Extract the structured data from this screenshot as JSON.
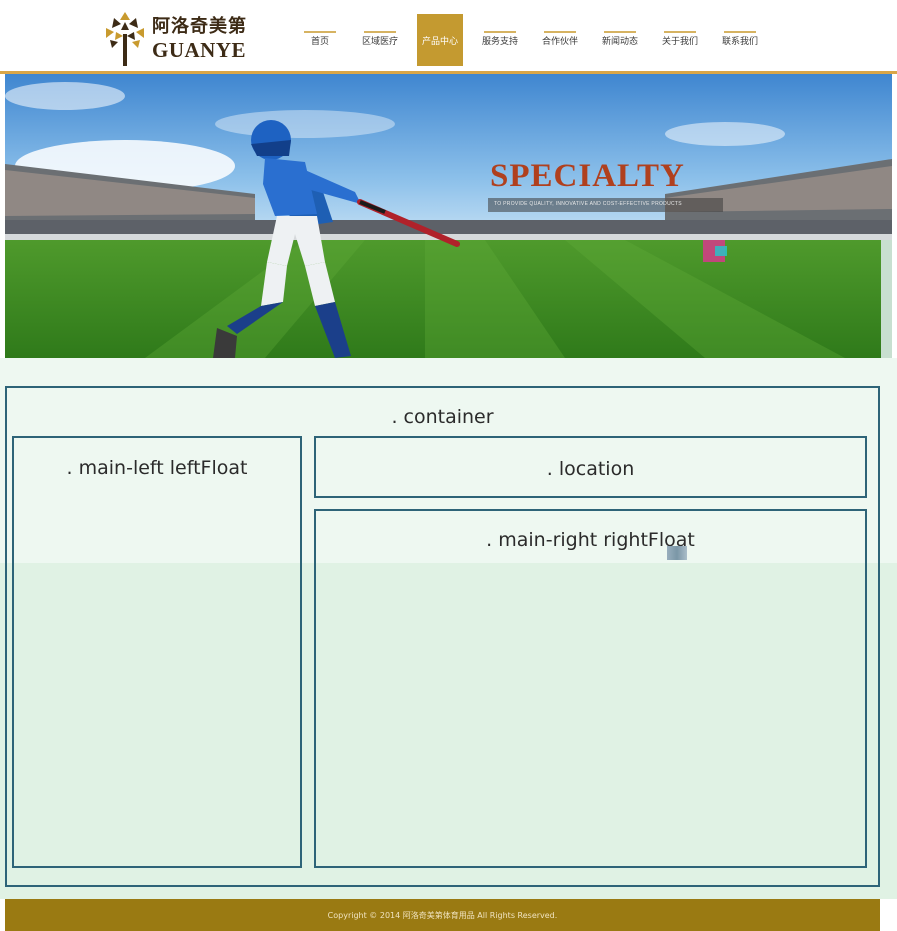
{
  "brand": {
    "name_cn": "阿洛奇美第",
    "name_en": "GUANYE"
  },
  "nav": {
    "items": [
      {
        "label": "首页"
      },
      {
        "label": "区域医疗"
      },
      {
        "label": "产品中心",
        "active": true
      },
      {
        "label": "服务支持"
      },
      {
        "label": "合作伙伴"
      },
      {
        "label": "新闻动态"
      },
      {
        "label": "关于我们"
      },
      {
        "label": "联系我们"
      }
    ],
    "accent_color": "#c49a30"
  },
  "banner": {
    "headline": "SPECIALTY",
    "subline": "TO PROVIDE QUALITY, INNOVATIVE AND COST-EFFECTIVE PRODUCTS",
    "headline_color": "#b0401e"
  },
  "layout_labels": {
    "container": ". container",
    "main_left": ". main-left leftFloat",
    "location": ". location",
    "main_right": ". main-right rightFloat"
  },
  "footer": {
    "copyright": "Copyright © 2014 阿洛奇美第体育用品 All Rights Reserved.",
    "color": "#9a7a12"
  }
}
